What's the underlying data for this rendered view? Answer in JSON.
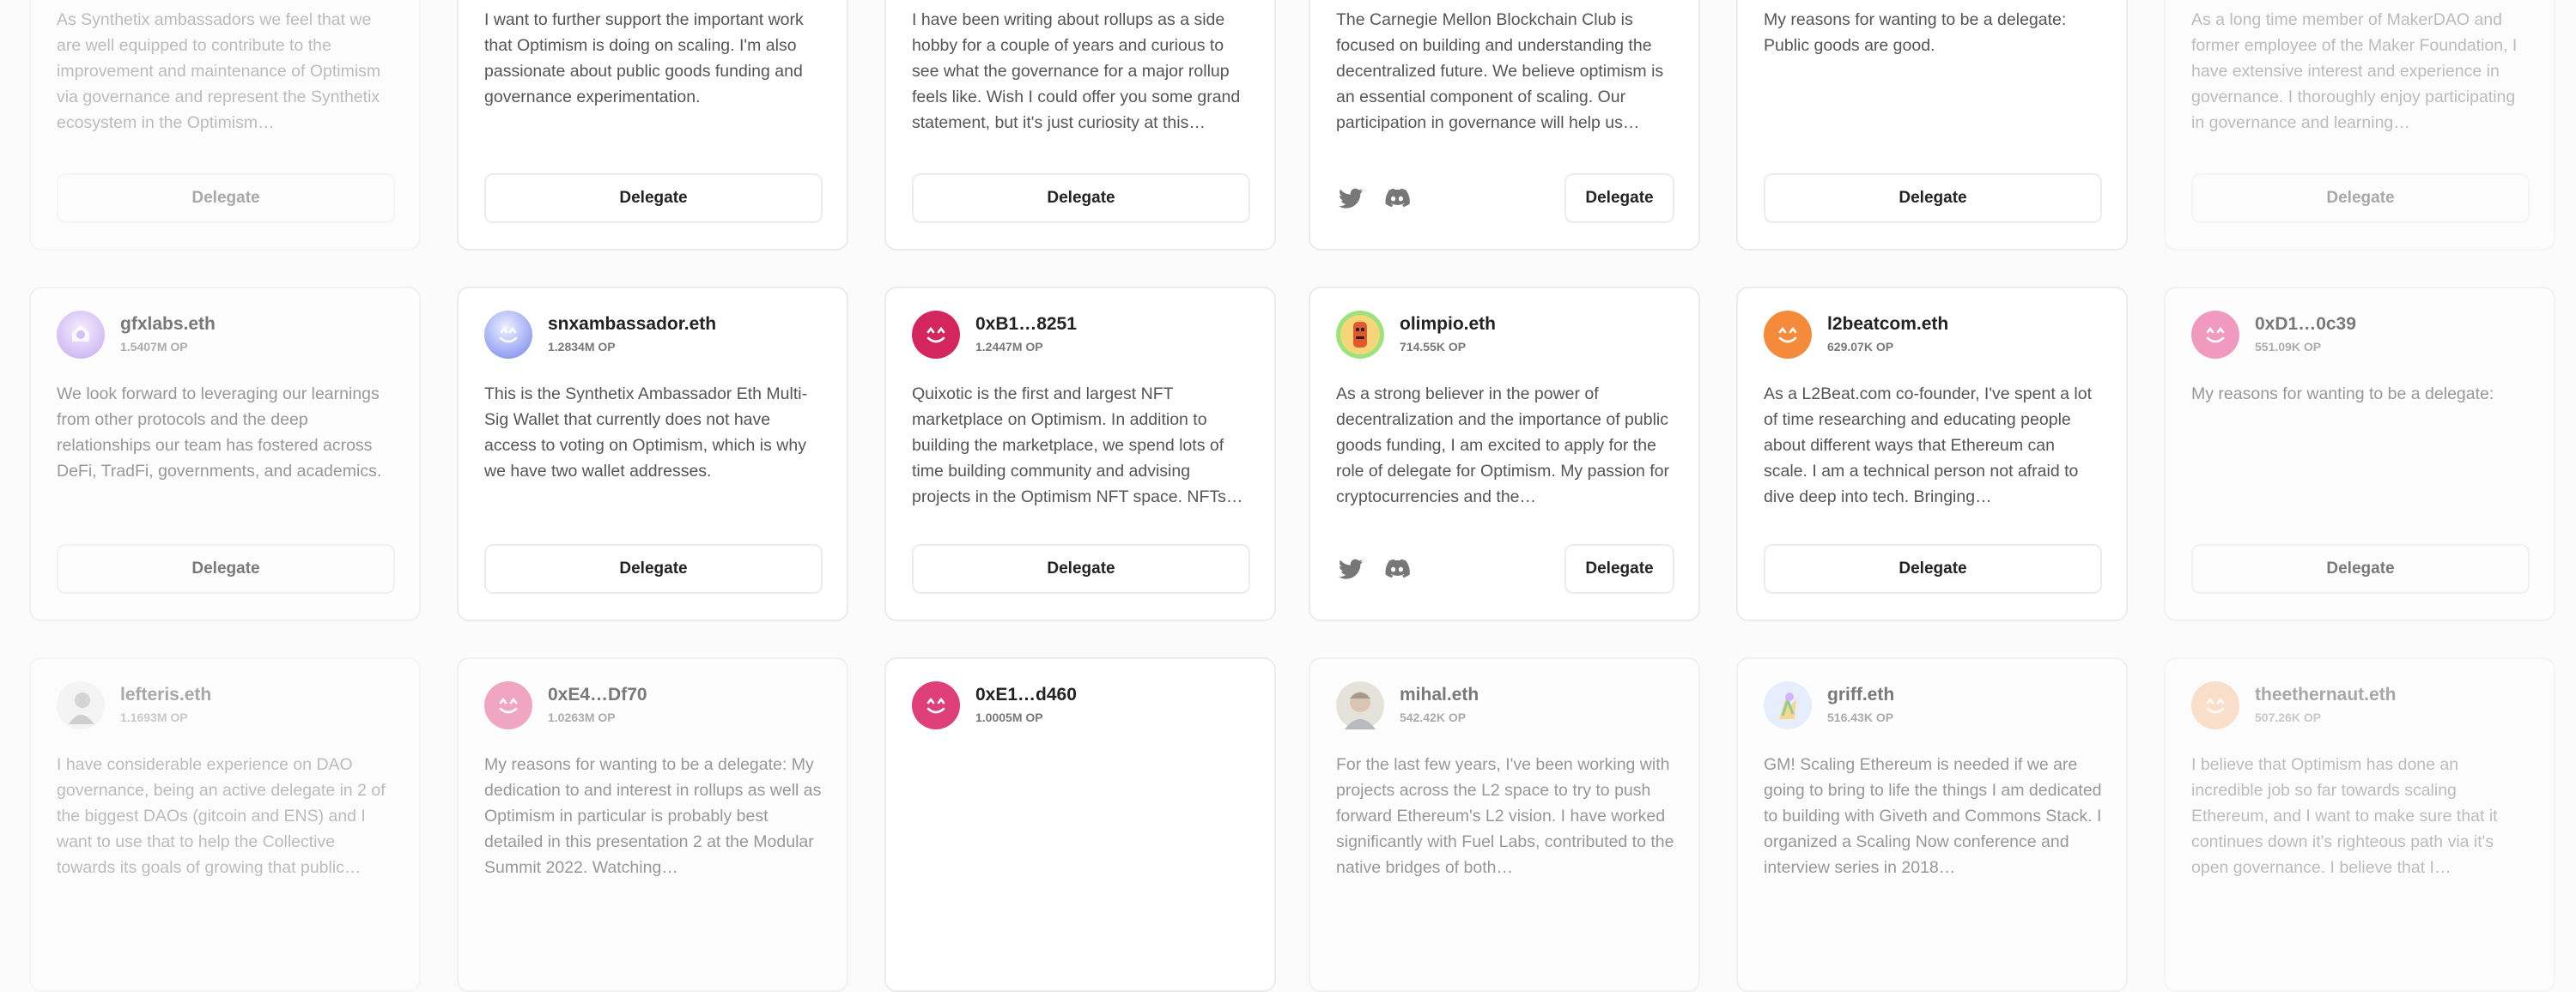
{
  "button_label": "Delegate",
  "colors": {
    "card_border": "#ececec",
    "text": "#222222",
    "muted": "#777777"
  },
  "delegates": [
    {
      "name": "",
      "op": "",
      "bio": "As Synthetix ambassadors we feel that we are well equipped to contribute to the improvement and maintenance of Optimism via governance and represent the Synthetix ecosystem in the Optimism…",
      "avatar": "none",
      "socials": []
    },
    {
      "name": "",
      "op": "",
      "bio": "I want to further support the important work that Optimism is doing on scaling. I'm also passionate about public goods funding and governance experimentation.",
      "avatar": "none",
      "socials": []
    },
    {
      "name": "",
      "op": "",
      "bio": "I have been writing about rollups as a side hobby for a couple of years and curious to see what the governance for a major rollup feels like. Wish I could offer you some grand statement, but it's just curiosity at this…",
      "avatar": "none",
      "socials": []
    },
    {
      "name": "",
      "op": "",
      "bio": "The Carnegie Mellon Blockchain Club is focused on building and understanding the decentralized future. We believe optimism is an essential component of scaling. Our participation in governance will help us…",
      "avatar": "none",
      "socials": [
        "twitter-icon",
        "discord-icon"
      ]
    },
    {
      "name": "",
      "op": "",
      "bio": "My reasons for wanting to be a delegate: Public goods are good.",
      "avatar": "none",
      "socials": []
    },
    {
      "name": "",
      "op": "",
      "bio": "As a long time member of MakerDAO and former employee of the Maker Foundation, I have extensive interest and experience in governance. I thoroughly enjoy participating in governance and learning…",
      "avatar": "none",
      "socials": []
    },
    {
      "name": "gfxlabs.eth",
      "op": "1.5407M OP",
      "bio": "We look forward to leveraging our learnings from other protocols and the deep relationships our team has fostered across DeFi, TradFi, governments, and academics.",
      "avatar": "gfx",
      "socials": []
    },
    {
      "name": "snxambassador.eth",
      "op": "1.2834M OP",
      "bio": "This is the Synthetix Ambassador Eth Multi-Sig Wallet that currently does not have access to voting on Optimism, which is why we have two wallet addresses.",
      "avatar": "snx",
      "socials": []
    },
    {
      "name": "0xB1…8251",
      "op": "1.2447M OP",
      "bio": "Quixotic is the first and largest NFT marketplace on Optimism. In addition to building the marketplace, we spend lots of time building community and advising projects in the Optimism NFT space. NFTs…",
      "avatar": "smiley-red",
      "socials": []
    },
    {
      "name": "olimpio.eth",
      "op": "714.55K OP",
      "bio": "As a strong believer in the power of decentralization and the importance of public goods funding, I am excited to apply for the role of delegate for Optimism. My passion for cryptocurrencies and the…",
      "avatar": "olimpio",
      "socials": [
        "twitter-icon",
        "discord-icon"
      ]
    },
    {
      "name": "l2beatcom.eth",
      "op": "629.07K OP",
      "bio": "As a L2Beat.com co-founder, I've spent a lot of time researching and educating people about different ways that Ethereum can scale. I am a technical person not afraid to dive deep into tech. Bringing…",
      "avatar": "smiley-orange",
      "socials": []
    },
    {
      "name": "0xD1…0c39",
      "op": "551.09K OP",
      "bio": "My reasons for wanting to be a delegate:",
      "avatar": "smiley-pink",
      "socials": []
    },
    {
      "name": "lefteris.eth",
      "op": "1.1693M OP",
      "bio": "I have considerable experience on DAO governance, being an active delegate in 2 of the biggest DAOs (gitcoin and ENS) and I want to use that to help the Collective towards its goals of growing that public…",
      "avatar": "lefteris",
      "socials": []
    },
    {
      "name": "0xE4…Df70",
      "op": "1.0263M OP",
      "bio": "My reasons for wanting to be a delegate: My dedication to and interest in rollups as well as Optimism in particular is probably best detailed in this presentation 2 at the Modular Summit 2022. Watching…",
      "avatar": "smiley-pink",
      "socials": []
    },
    {
      "name": "0xE1…d460",
      "op": "1.0005M OP",
      "bio": "",
      "avatar": "smiley-red",
      "socials": []
    },
    {
      "name": "mihal.eth",
      "op": "542.42K OP",
      "bio": "For the last few years, I've been working with projects across the L2 space to try to push forward Ethereum's L2 vision. I have worked significantly with Fuel Labs, contributed to the native bridges of both…",
      "avatar": "mihal",
      "socials": []
    },
    {
      "name": "griff.eth",
      "op": "516.43K OP",
      "bio": "GM! Scaling Ethereum is needed if we are going to bring to life the things I am dedicated to building with Giveth and Commons Stack. I organized a Scaling Now conference and interview series in 2018…",
      "avatar": "griff",
      "socials": []
    },
    {
      "name": "theethernaut.eth",
      "op": "507.26K OP",
      "bio": "I believe that Optimism has done an incredible job so far towards scaling Ethereum, and I want to make sure that it continues down it's righteous path via it's open governance. I believe that I…",
      "avatar": "smiley-peach",
      "socials": []
    }
  ]
}
